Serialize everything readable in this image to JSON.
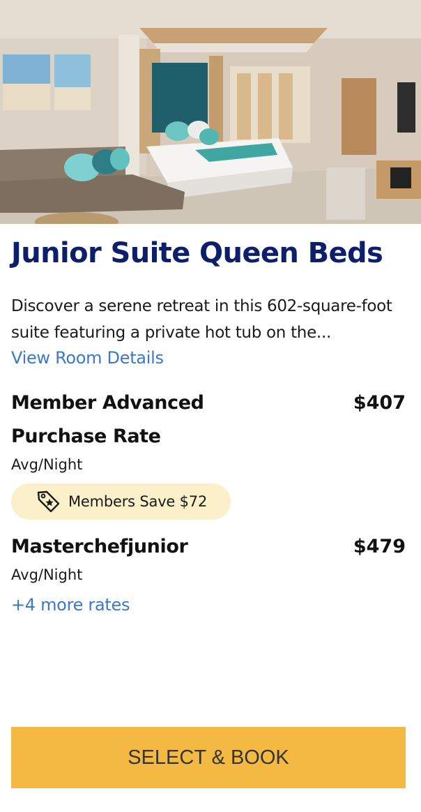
{
  "room": {
    "title": "Junior Suite Queen Beds",
    "description": "Discover a serene retreat in this 602-square-foot suite featuring a private hot tub on the...",
    "details_link": "View Room Details"
  },
  "rates": [
    {
      "name": "Member Advanced Purchase Rate",
      "price": "$407",
      "sub": "Avg/Night"
    },
    {
      "name": "Masterchefjunior",
      "price": "$479",
      "sub": "Avg/Night"
    }
  ],
  "badge": {
    "text": "Members Save $72",
    "icon": "price-tag-icon",
    "color": "#fbf0c9"
  },
  "more_rates_link": "+4 more rates",
  "cta": {
    "label": "SELECT & BOOK",
    "color": "#f4b942"
  },
  "colors": {
    "title": "#0d1f6b",
    "link": "#3a78c9"
  }
}
